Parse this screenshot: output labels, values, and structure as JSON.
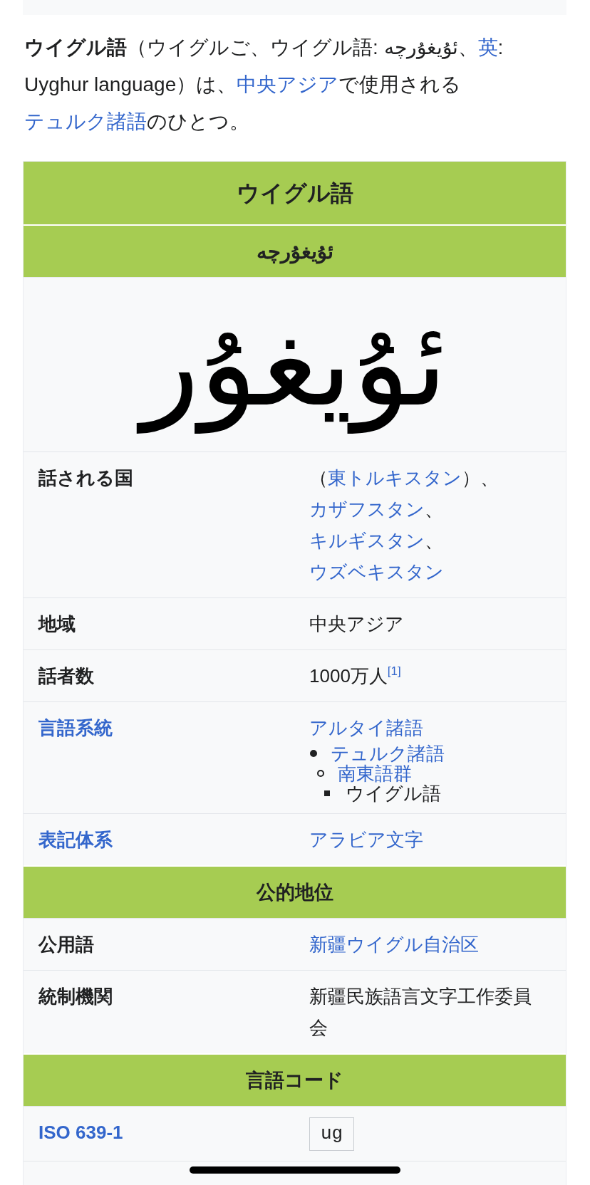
{
  "intro": [
    {
      "kind": "text",
      "text": "**ウイグル語**（ウイグルご、ウイグル語: ئۇيغۇرچە、"
    },
    {
      "kind": "link",
      "text": "英"
    },
    {
      "kind": "text",
      "text": ": Uyghur language）は、"
    },
    {
      "kind": "link",
      "text": "中央アジア"
    },
    {
      "kind": "text",
      "text": "で使用される"
    },
    {
      "kind": "link",
      "text": "テュルク諸語"
    },
    {
      "kind": "text",
      "text": "のひとつ。"
    }
  ],
  "infobox": {
    "rows": [
      {
        "kind": "title",
        "text": "ウイグル語"
      },
      {
        "kind": "header",
        "text": "ئۇيغۇرچە"
      },
      {
        "kind": "image",
        "text": "ئۇيغۇر"
      },
      {
        "kind": "field",
        "label": "話される国",
        "label_link": false,
        "value": [
          {
            "kind": "text",
            "text": "（"
          },
          {
            "kind": "link",
            "text": "東トルキスタン"
          },
          {
            "kind": "text",
            "text": "）、"
          },
          {
            "kind": "link",
            "text": "カザフスタン"
          },
          {
            "kind": "text",
            "text": "、"
          },
          {
            "kind": "link",
            "text": "キルギスタン"
          },
          {
            "kind": "text",
            "text": "、"
          },
          {
            "kind": "link",
            "text": "ウズベキスタン"
          }
        ]
      },
      {
        "kind": "field",
        "label": "地域",
        "label_link": false,
        "value": [
          {
            "kind": "text",
            "text": "中央アジア"
          }
        ]
      },
      {
        "kind": "field",
        "label": "話者数",
        "label_link": false,
        "value": [
          {
            "kind": "text",
            "text": "1000万人"
          },
          {
            "kind": "ref",
            "text": "[1]"
          }
        ]
      },
      {
        "kind": "field",
        "label": "言語系統",
        "label_link": true,
        "value": [
          {
            "kind": "link",
            "text": "アルタイ諸語"
          }
        ],
        "tree": [
          {
            "text": "テュルク諸語",
            "link": true,
            "children": [
              {
                "text": "南東語群",
                "link": true,
                "children": [
                  {
                    "text": "ウイグル語",
                    "link": false
                  }
                ]
              }
            ]
          }
        ]
      },
      {
        "kind": "field",
        "label": "表記体系",
        "label_link": true,
        "value": [
          {
            "kind": "link",
            "text": "アラビア文字"
          }
        ]
      },
      {
        "kind": "header",
        "text": "公的地位"
      },
      {
        "kind": "field",
        "label": "公用語",
        "label_link": false,
        "value": [
          {
            "kind": "link",
            "text": "新疆ウイグル自治区"
          }
        ]
      },
      {
        "kind": "field",
        "label": "統制機関",
        "label_link": false,
        "value": [
          {
            "kind": "text",
            "text": "新疆民族語言文字工作委員会"
          }
        ]
      },
      {
        "kind": "header",
        "text": "言語コード"
      },
      {
        "kind": "field",
        "label": "ISO 639-1",
        "label_link": true,
        "value": [
          {
            "kind": "code",
            "text": "ug"
          }
        ]
      }
    ]
  }
}
